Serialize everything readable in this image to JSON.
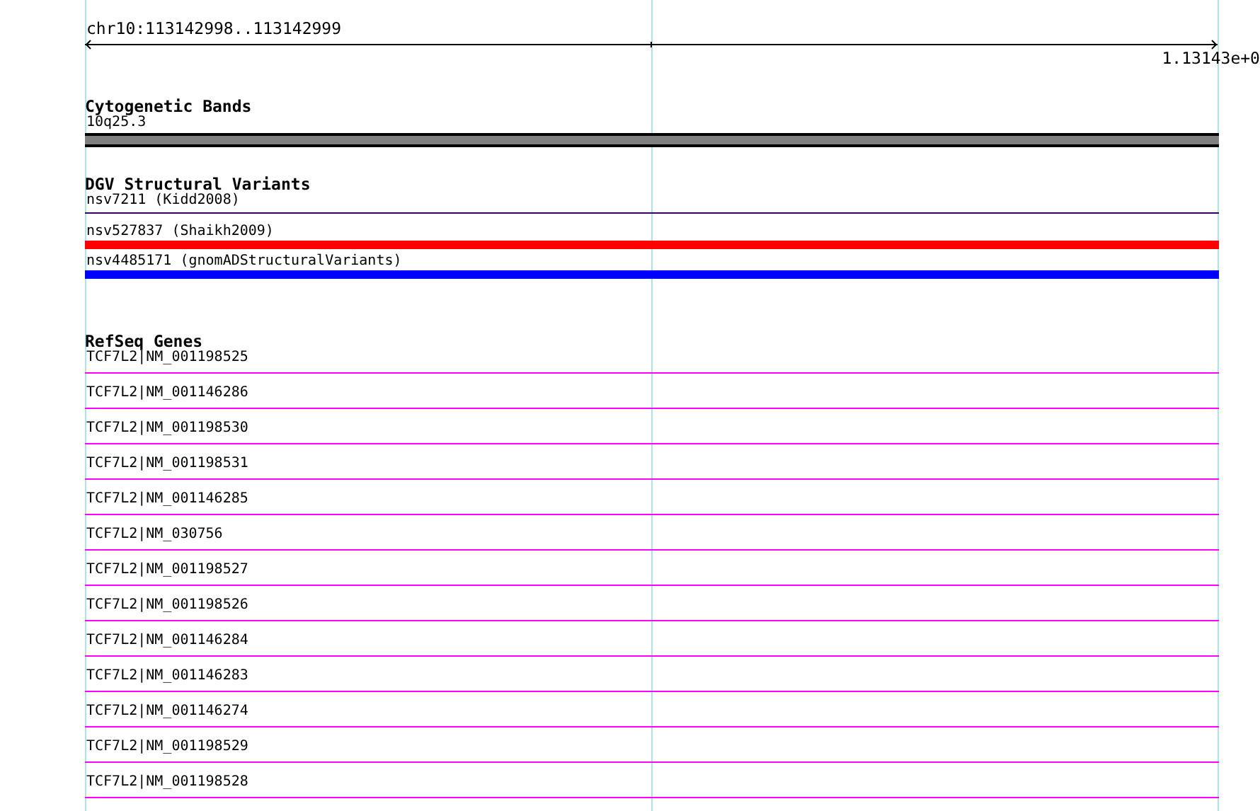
{
  "ruler": {
    "range": "chr10:113142998..113142999",
    "tick_label": "1.13143e+0"
  },
  "tracks": [
    {
      "kind": "cytoband",
      "title": "Cytogenetic Bands",
      "features": [
        {
          "label": "10q25.3",
          "color": "#808080"
        }
      ]
    },
    {
      "kind": "variants",
      "title": "DGV Structural Variants",
      "features": [
        {
          "label": "nsv7211 (Kidd2008)",
          "color": "#330066",
          "thick": false
        },
        {
          "label": "nsv527837 (Shaikh2009)",
          "color": "#ff0000",
          "thick": true
        },
        {
          "label": "nsv4485171 (gnomADStructuralVariants)",
          "color": "#0000ff",
          "thick": true
        }
      ]
    },
    {
      "kind": "genes",
      "title": "RefSeq Genes",
      "features": [
        {
          "label": "TCF7L2|NM_001198525"
        },
        {
          "label": "TCF7L2|NM_001146286"
        },
        {
          "label": "TCF7L2|NM_001198530"
        },
        {
          "label": "TCF7L2|NM_001198531"
        },
        {
          "label": "TCF7L2|NM_001146285"
        },
        {
          "label": "TCF7L2|NM_030756"
        },
        {
          "label": "TCF7L2|NM_001198527"
        },
        {
          "label": "TCF7L2|NM_001198526"
        },
        {
          "label": "TCF7L2|NM_001146284"
        },
        {
          "label": "TCF7L2|NM_001146283"
        },
        {
          "label": "TCF7L2|NM_001146274"
        },
        {
          "label": "TCF7L2|NM_001198529"
        },
        {
          "label": "TCF7L2|NM_001198528"
        }
      ]
    }
  ]
}
